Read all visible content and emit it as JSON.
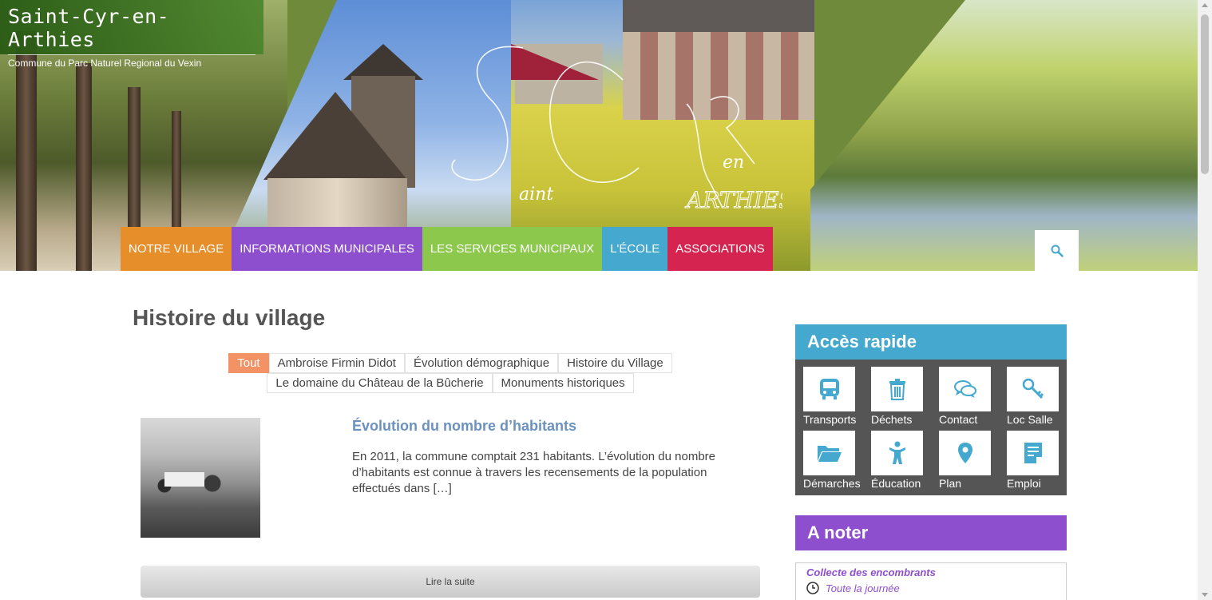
{
  "site": {
    "title": "Saint-Cyr-en-Arthies",
    "subtitle": "Commune du Parc Naturel Regional du Vexin",
    "monogram_lines": [
      "S",
      "aint",
      "C",
      "yR",
      "en",
      "ARTHIES"
    ]
  },
  "nav": {
    "items": [
      {
        "label": "NOTRE VILLAGE",
        "color": "#e58e2a"
      },
      {
        "label": "INFORMATIONS MUNICIPALES",
        "color": "#8e4fcf"
      },
      {
        "label": "LES SERVICES MUNICIPAUX",
        "color": "#8cc84b"
      },
      {
        "label": "L'ÉCOLE",
        "color": "#44a8cf"
      },
      {
        "label": "ASSOCIATIONS",
        "color": "#d4244f"
      }
    ],
    "search_icon": "search-icon"
  },
  "main": {
    "page_title": "Histoire du village",
    "filters_row1": [
      "Tout",
      "Ambroise Firmin Didot",
      "Évolution démographique",
      "Histoire du Village"
    ],
    "filters_row2": [
      "Le domaine du Château de la Bûcherie",
      "Monuments historiques"
    ],
    "active_filter": "Tout",
    "article": {
      "title": "Évolution du nombre d’habitants",
      "excerpt": "En 2011, la commune comptait 231 habitants. L’évolution du nombre d’habitants est connue à travers les recensements de la population effectués dans […]",
      "read_more": "Lire la suite"
    }
  },
  "sidebar": {
    "acces": {
      "title": "Accès rapide",
      "items": [
        {
          "label": "Transports",
          "icon": "bus-icon"
        },
        {
          "label": "Déchets",
          "icon": "trash-icon"
        },
        {
          "label": "Contact",
          "icon": "chat-icon"
        },
        {
          "label": "Loc Salle",
          "icon": "key-icon"
        },
        {
          "label": "Démarches",
          "icon": "folder-icon"
        },
        {
          "label": "Éducation",
          "icon": "child-icon"
        },
        {
          "label": "Plan",
          "icon": "map-pin-icon"
        },
        {
          "label": "Emploi",
          "icon": "document-icon"
        }
      ]
    },
    "noter": {
      "title": "A noter",
      "event": "Collecte des encombrants",
      "time": "Toute la journée"
    }
  },
  "colors": {
    "accent_blue": "#44a8cf",
    "accent_purple": "#8e4fcf",
    "accent_orange": "#f39264",
    "title_blue": "#6b92bf"
  }
}
